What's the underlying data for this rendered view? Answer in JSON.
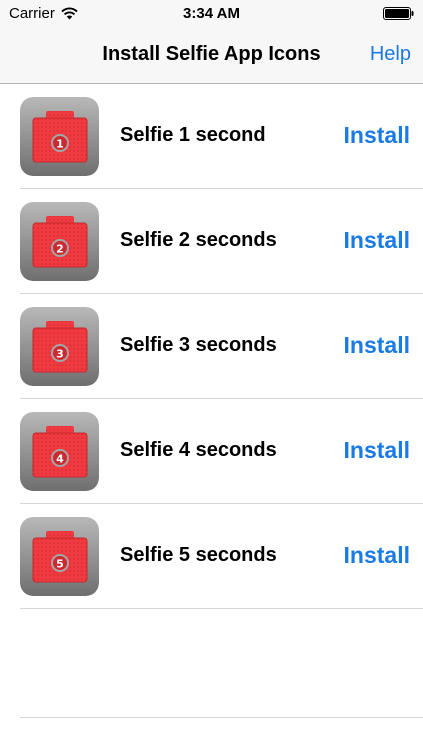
{
  "status_bar": {
    "carrier": "Carrier",
    "time": "3:34 AM"
  },
  "nav": {
    "title": "Install Selfie App Icons",
    "help_label": "Help"
  },
  "rows": [
    {
      "label": "Selfie 1 second",
      "badge": "1",
      "action": "Install"
    },
    {
      "label": "Selfie 2 seconds",
      "badge": "2",
      "action": "Install"
    },
    {
      "label": "Selfie 3 seconds",
      "badge": "3",
      "action": "Install"
    },
    {
      "label": "Selfie 4 seconds",
      "badge": "4",
      "action": "Install"
    },
    {
      "label": "Selfie 5 seconds",
      "badge": "5",
      "action": "Install"
    }
  ],
  "icons": {
    "row_icon": "camera-icon",
    "wifi": "wifi-icon",
    "battery": "battery-icon"
  },
  "colors": {
    "accent": "#1a7be4",
    "camera_red": "#e8383d",
    "icon_gray": "#8a8a8a"
  }
}
